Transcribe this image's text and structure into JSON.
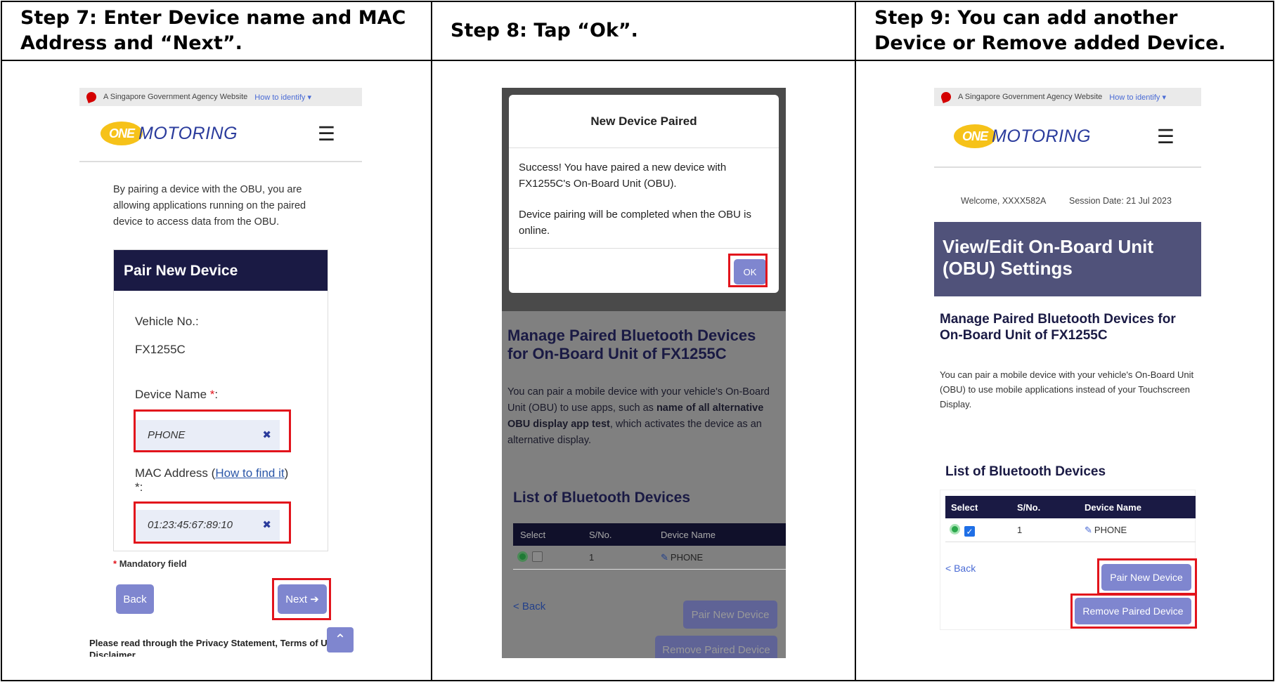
{
  "headers": [
    "Step 7: Enter Device name and MAC Address and “Next”.",
    "Step 8: Tap “Ok”.",
    "Step 9: You can add another Device or Remove added Device."
  ],
  "gov_bar": {
    "text": "A Singapore Government Agency Website",
    "how": "How to identify"
  },
  "logo": {
    "one": "ONE",
    "motoring": "MOTORING"
  },
  "step7": {
    "intro": "By pairing a device with the OBU, you are allowing applications running on the paired device to access data from the OBU.",
    "panel_title": "Pair New Device",
    "vehicle_label": "Vehicle No.:",
    "vehicle_value": "FX1255C",
    "device_label": "Device Name",
    "device_value": "PHONE",
    "mac_label": "MAC Address (",
    "mac_link": "How to find it",
    "mac_label_end": ") *:",
    "mac_value": "01:23:45:67:89:10",
    "mandatory": "Mandatory field",
    "back": "Back",
    "next": "Next",
    "footer": "Please read through the Privacy Statement, Terms of Us",
    "footer2": "Disclaimer"
  },
  "step8": {
    "modal_title": "New Device Paired",
    "modal_p1": "Success! You have paired a new device with FX1255C's On-Board Unit (OBU).",
    "modal_p2": "Device pairing will be completed when the OBU is online.",
    "ok": "OK",
    "manage_title": "Manage Paired Bluetooth Devices for On-Board Unit of FX1255C",
    "desc_pre": "You can pair a mobile device with your vehicle's On-Board Unit (OBU) to use apps, such as ",
    "desc_bold": "name of all alternative OBU display app test",
    "desc_post": ", which activates the device as an alternative display.",
    "list_title": "List of Bluetooth Devices",
    "back": "< Back",
    "pair": "Pair New Device",
    "remove": "Remove Paired Device"
  },
  "step9": {
    "welcome": "Welcome, XXXX582A",
    "session": "Session Date: 21 Jul 2023",
    "banner": "View/Edit On-Board Unit (OBU) Settings",
    "manage_title": "Manage Paired Bluetooth Devices for On-Board Unit of FX1255C",
    "desc": "You can pair a mobile device with your vehicle's On-Board Unit (OBU) to use mobile applications instead of your Touchscreen Display.",
    "list_title": "List of Bluetooth Devices",
    "back": "< Back",
    "pair": "Pair New Device",
    "remove": "Remove Paired Device"
  },
  "table": {
    "columns": [
      "Select",
      "S/No.",
      "Device Name"
    ],
    "row": {
      "sno": "1",
      "name": "PHONE"
    }
  },
  "colors": {
    "navy": "#1a1a44",
    "button": "#7f86cf",
    "highlight": "#e2141c",
    "banner": "#50527a"
  }
}
